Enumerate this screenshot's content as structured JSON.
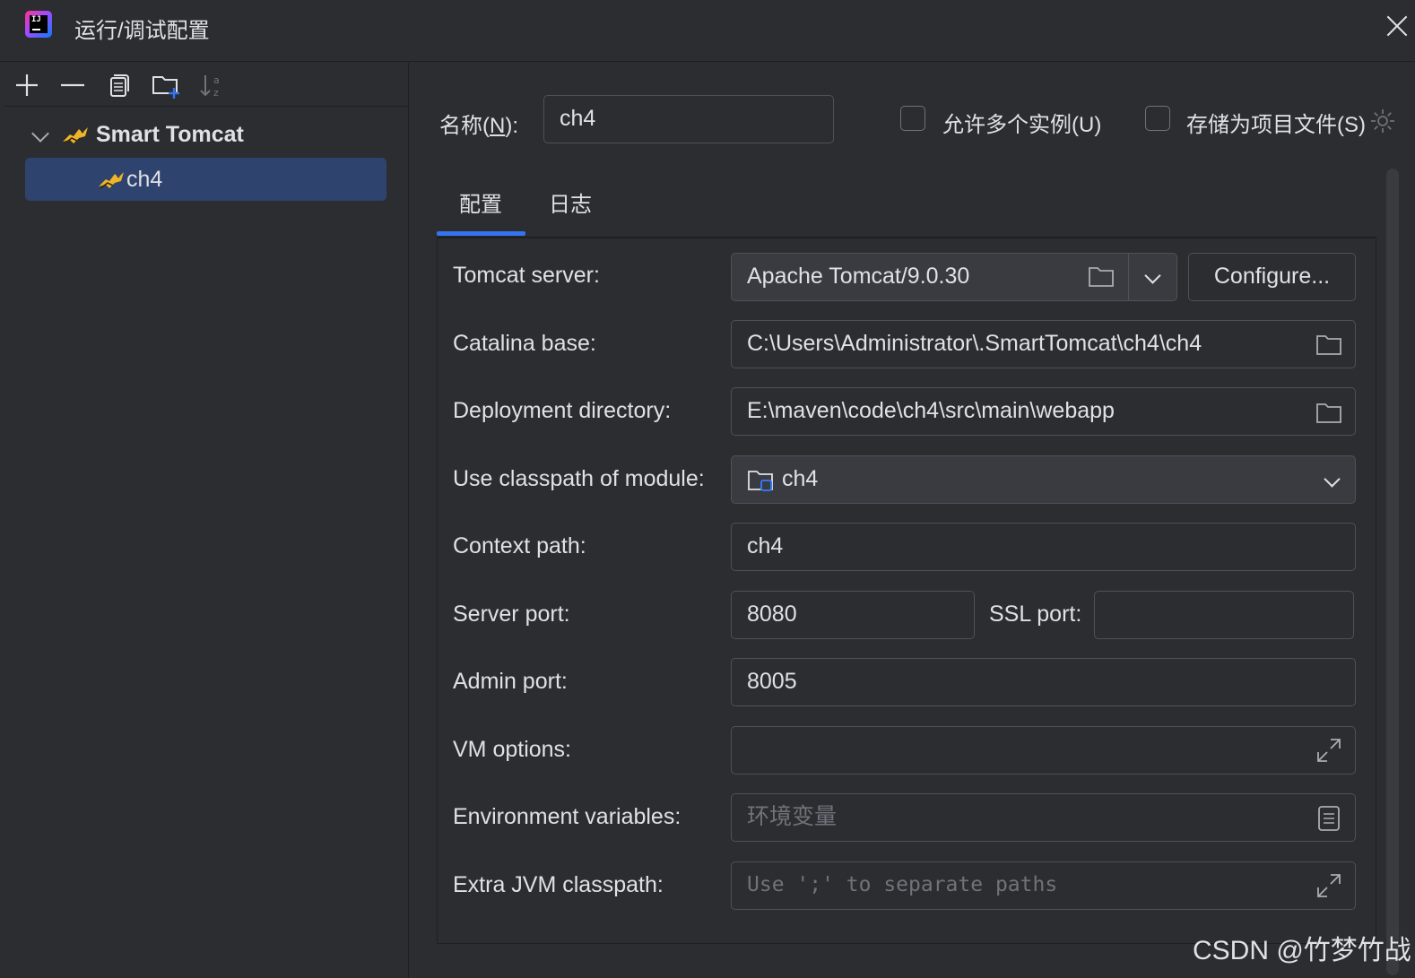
{
  "window": {
    "title": "运行/调试配置"
  },
  "tree": {
    "group": "Smart Tomcat",
    "item": "ch4"
  },
  "header": {
    "name_label_prefix": "名称(",
    "name_label_mnemonic": "N",
    "name_label_suffix": "):",
    "name_value": "ch4",
    "allow_multiple": "允许多个实例(U)",
    "store_as_project_file": "存储为项目文件(S)"
  },
  "tabs": [
    {
      "label": "配置",
      "active": true
    },
    {
      "label": "日志",
      "active": false
    }
  ],
  "form": {
    "tomcat_server_label": "Tomcat server:",
    "tomcat_server_value": "Apache Tomcat/9.0.30",
    "configure_button": "Configure...",
    "catalina_base_label": "Catalina base:",
    "catalina_base_value": "C:\\Users\\Administrator\\.SmartTomcat\\ch4\\ch4",
    "deployment_dir_label": "Deployment directory:",
    "deployment_dir_value": "E:\\maven\\code\\ch4\\src\\main\\webapp",
    "classpath_module_label": "Use classpath of module:",
    "classpath_module_value": "ch4",
    "context_path_label": "Context path:",
    "context_path_value": "ch4",
    "server_port_label": "Server port:",
    "server_port_value": "8080",
    "ssl_port_label": "SSL port:",
    "ssl_port_value": "",
    "admin_port_label": "Admin port:",
    "admin_port_value": "8005",
    "vm_options_label": "VM options:",
    "vm_options_value": "",
    "env_vars_label": "Environment variables:",
    "env_vars_placeholder": "环境变量",
    "extra_cp_label": "Extra JVM classpath:",
    "extra_cp_placeholder": "Use ';' to separate paths"
  },
  "watermark": "CSDN @竹梦竹战",
  "colors": {
    "accent": "#3574f0",
    "selection": "#2e436e",
    "background": "#2b2d30"
  }
}
